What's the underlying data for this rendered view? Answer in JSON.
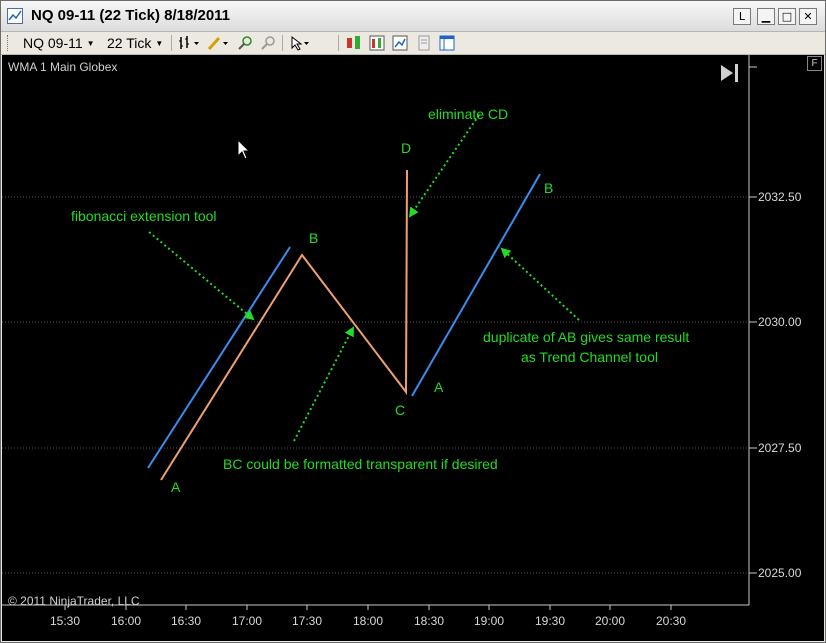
{
  "window": {
    "title": "NQ 09-11 (22 Tick)  8/18/2011",
    "controls": {
      "link_label": "L",
      "minimize_label": "▁",
      "maximize_label": "□",
      "close_label": "✕"
    }
  },
  "toolbar": {
    "instrument": "NQ 09-11",
    "interval": "22 Tick"
  },
  "chart": {
    "indicator_label": "WMA 1 Main Globex",
    "copyright": "© 2011 NinjaTrader, LLC",
    "f_button": "F",
    "y_ticks": [
      "2032.50",
      "2030.00",
      "2027.50",
      "2025.00"
    ],
    "x_ticks": [
      "15:30",
      "16:00",
      "16:30",
      "17:00",
      "17:30",
      "18:00",
      "18:30",
      "19:00",
      "19:30",
      "20:00",
      "20:30"
    ],
    "annotations": {
      "eliminate_cd": "eliminate CD",
      "fib_tool": "fibonacci extension tool",
      "duplicate_ab_line1": "duplicate of AB gives same result",
      "duplicate_ab_line2": "as Trend Channel tool",
      "bc_transparent": "BC could be formatted transparent if desired"
    },
    "points": {
      "a1": "A",
      "b1": "B",
      "c": "C",
      "d": "D",
      "a2": "A",
      "b2": "B"
    },
    "colors": {
      "background": "#000000",
      "annotation": "#22dd22",
      "blue_line": "#3a8cf0",
      "orange_line": "#f0a070",
      "grid": "#555555"
    }
  }
}
